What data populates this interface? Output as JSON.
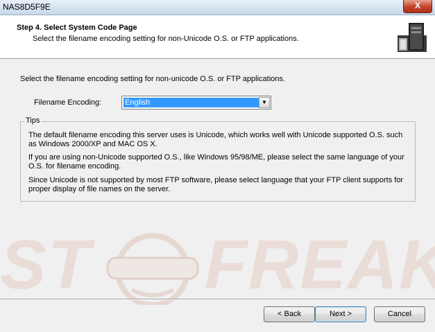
{
  "window": {
    "title": "NAS8D5F9E",
    "close_label": "X"
  },
  "header": {
    "step_title": "Step 4. Select System Code Page",
    "subtitle": "Select the filename encoding setting for non-Unicode O.S. or FTP applications."
  },
  "main": {
    "intro": "Select the filename encoding setting for non-unicode O.S. or FTP applications.",
    "encoding": {
      "label": "Filename Encoding:",
      "selected": "English",
      "arrow_icon": "chevron-down-icon"
    }
  },
  "tips": {
    "legend": "Tips",
    "p1": "The default filename encoding this server uses is Unicode, which works well with Unicode supported O.S. such as Windows 2000/XP and MAC OS X.",
    "p2": "If you are using non-Unicode supported O.S., like Windows 95/98/ME, please select the same language of your O.S. for filename encoding.",
    "p3": "Since Unicode is not supported by most FTP software, please select language that your FTP client supports for proper display of file names on the server."
  },
  "watermark": {
    "text_left": "ST",
    "text_right": "FREAKS"
  },
  "buttons": {
    "back": "< Back",
    "next": "Next >",
    "cancel": "Cancel"
  },
  "colors": {
    "selection": "#3399ff",
    "close_button": "#c1432a",
    "watermark": "#eadcd6"
  }
}
